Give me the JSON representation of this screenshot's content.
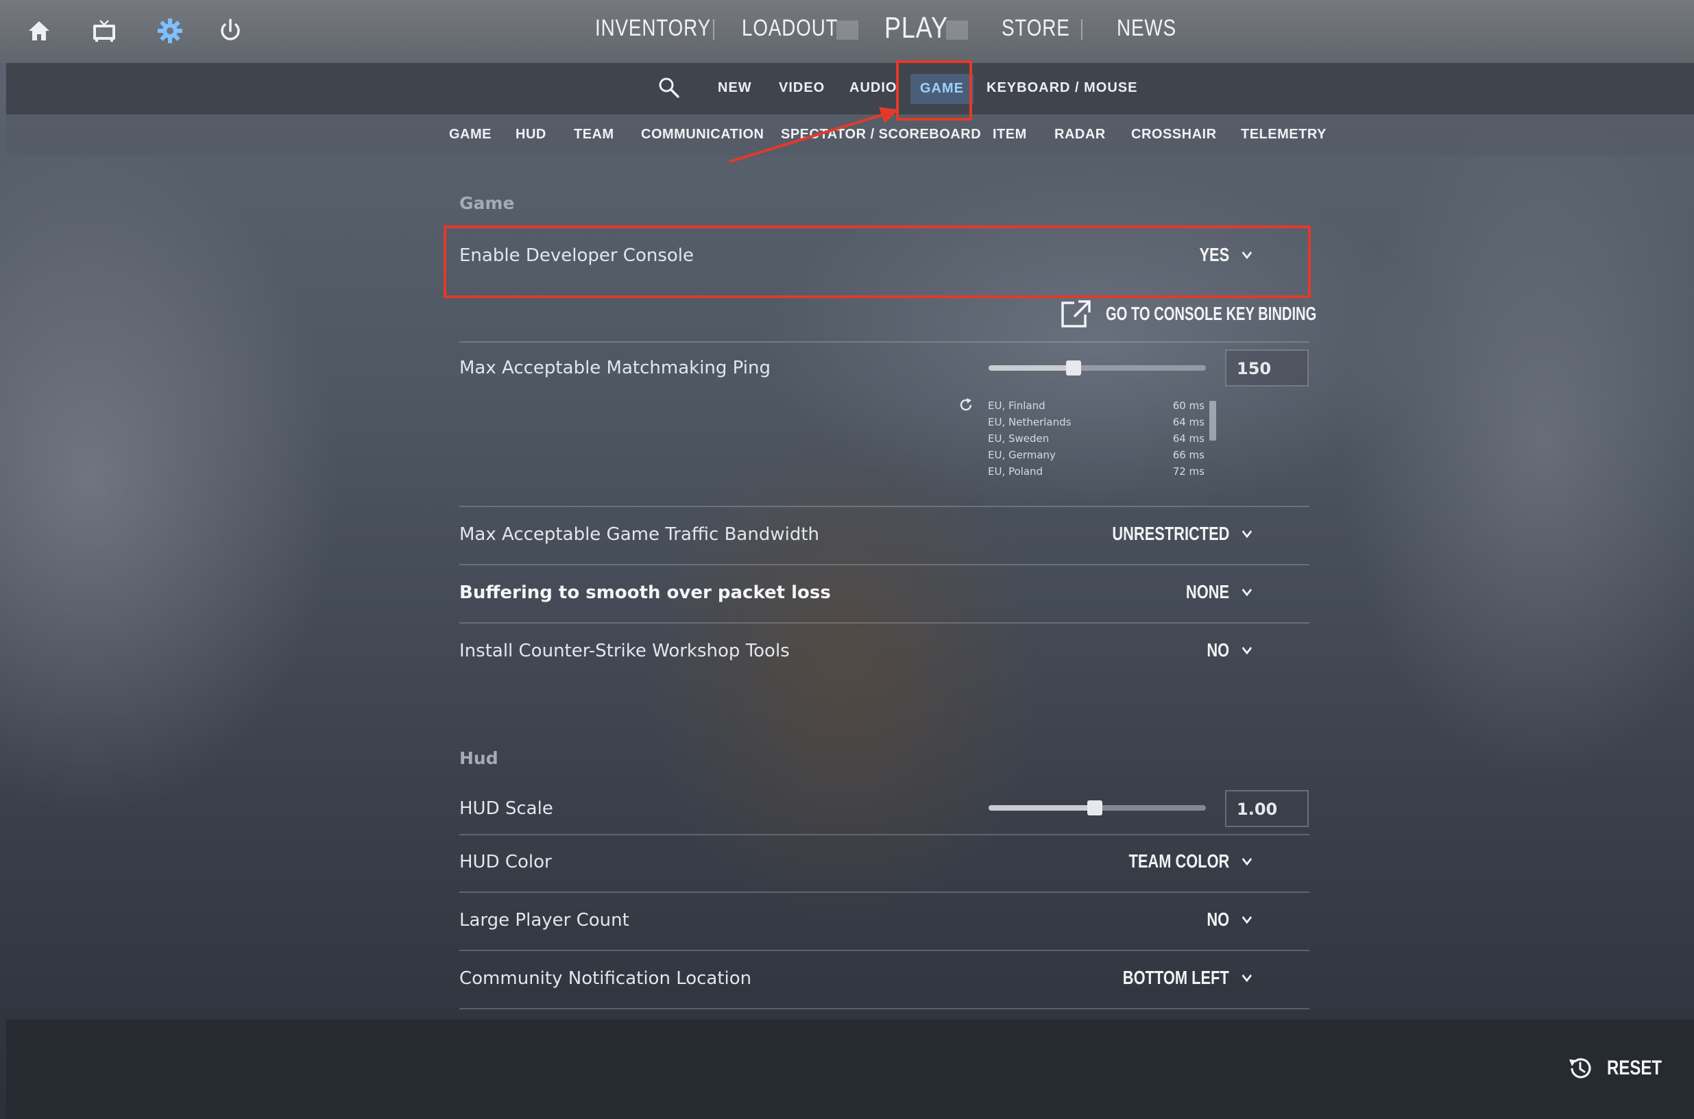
{
  "top_nav": {
    "items": [
      "INVENTORY",
      "LOADOUT",
      "PLAY",
      "STORE",
      "NEWS"
    ],
    "icons": [
      "home-icon",
      "tv-icon",
      "gear-icon",
      "power-icon"
    ]
  },
  "settings_tabs": {
    "items": [
      "NEW",
      "VIDEO",
      "AUDIO",
      "GAME",
      "KEYBOARD / MOUSE"
    ],
    "active": "GAME"
  },
  "categories": [
    "GAME",
    "HUD",
    "TEAM",
    "COMMUNICATION",
    "SPECTATOR / SCOREBOARD",
    "ITEM",
    "RADAR",
    "CROSSHAIR",
    "TELEMETRY"
  ],
  "sections": {
    "game": {
      "title": "Game",
      "developer_console": {
        "label": "Enable Developer Console",
        "value": "YES"
      },
      "console_link": "GO TO CONSOLE KEY BINDING",
      "max_ping": {
        "label": "Max Acceptable Matchmaking Ping",
        "value": "150",
        "slider_fraction": 0.39,
        "servers": [
          {
            "name": "EU, Finland",
            "ms": "60 ms"
          },
          {
            "name": "EU, Netherlands",
            "ms": "64 ms"
          },
          {
            "name": "EU, Sweden",
            "ms": "64 ms"
          },
          {
            "name": "EU, Germany",
            "ms": "66 ms"
          },
          {
            "name": "EU, Poland",
            "ms": "72 ms"
          }
        ]
      },
      "bandwidth": {
        "label": "Max Acceptable Game Traffic Bandwidth",
        "value": "UNRESTRICTED"
      },
      "buffering": {
        "label": "Buffering to smooth over packet loss",
        "value": "NONE"
      },
      "workshop": {
        "label": "Install Counter-Strike Workshop Tools",
        "value": "NO"
      }
    },
    "hud": {
      "title": "Hud",
      "hud_scale": {
        "label": "HUD Scale",
        "value": "1.00",
        "slider_fraction": 0.49
      },
      "hud_color": {
        "label": "HUD Color",
        "value": "TEAM COLOR"
      },
      "large_player_count": {
        "label": "Large Player Count",
        "value": "NO"
      },
      "notification_location": {
        "label": "Community Notification Location",
        "value": "BOTTOM LEFT"
      }
    }
  },
  "footer": {
    "reset_label": "RESET"
  },
  "colors": {
    "highlight": "#e23a2a",
    "active_tab_text": "#9ed0ff",
    "active_tab_bg": "#4a5f77"
  }
}
